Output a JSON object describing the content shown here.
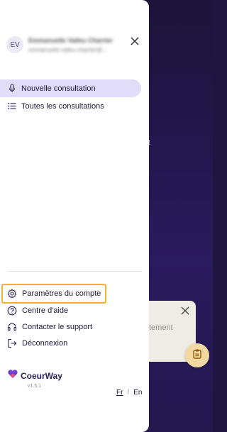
{
  "user": {
    "initials": "EV",
    "name": "Emmanuelle Valleu Charrier",
    "email": "emmanuelle.valleu.charrier@..."
  },
  "nav": {
    "new_consultation": "Nouvelle consultation",
    "all_consultations": "Toutes les consultations"
  },
  "menu": {
    "settings": "Paramètres du compte",
    "help": "Centre d'aide",
    "support": "Contacter le support",
    "logout": "Déconnexion"
  },
  "brand": {
    "name": "CoeurWay",
    "version": "v1.5.1"
  },
  "language": {
    "fr": "Fr",
    "separator": "/",
    "en": "En"
  },
  "background": {
    "partial_text_1": "t",
    "card_text": "tement"
  },
  "colors": {
    "accent_active": "#e1dcf7",
    "highlight_border": "#f0b03a",
    "background_dark": "#1e1640"
  }
}
